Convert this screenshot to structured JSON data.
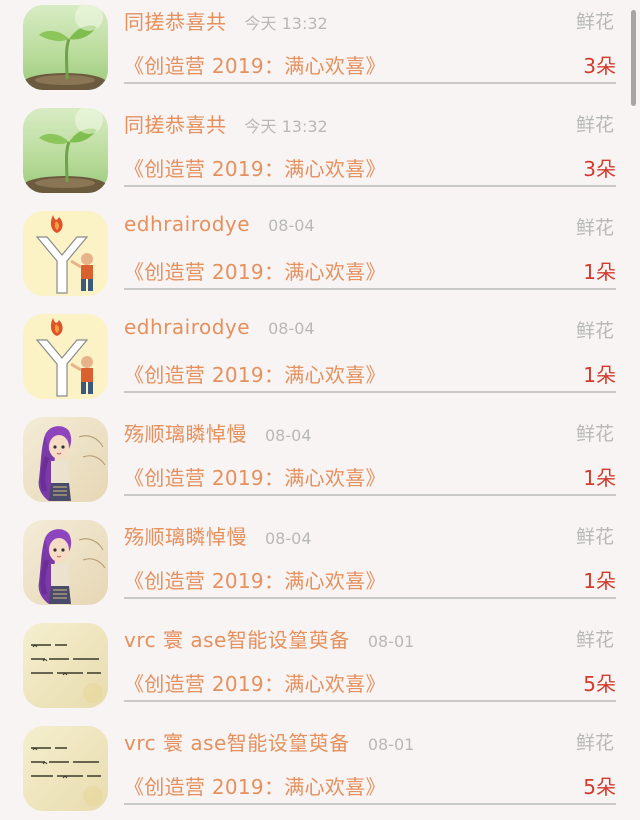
{
  "gift_list": {
    "items": [
      {
        "name": "同搓恭喜共",
        "time": "今天 13:32",
        "gift_type": "鲜花",
        "program": "《创造营 2019：满心欢喜》",
        "count": "3朵",
        "avatar_icon": "sprout-avatar-icon"
      },
      {
        "name": "同搓恭喜共",
        "time": "今天 13:32",
        "gift_type": "鲜花",
        "program": "《创造营 2019：满心欢喜》",
        "count": "3朵",
        "avatar_icon": "sprout-avatar-icon"
      },
      {
        "name": "edhrairodye",
        "time": "08-04",
        "gift_type": "鲜花",
        "program": "《创造营 2019：满心欢喜》",
        "count": "1朵",
        "avatar_icon": "torch-boy-avatar-icon"
      },
      {
        "name": "edhrairodye",
        "time": "08-04",
        "gift_type": "鲜花",
        "program": "《创造营 2019：满心欢喜》",
        "count": "1朵",
        "avatar_icon": "torch-boy-avatar-icon"
      },
      {
        "name": "殇顺璃瞵悼慢",
        "time": "08-04",
        "gift_type": "鲜花",
        "program": "《创造营 2019：满心欢喜》",
        "count": "1朵",
        "avatar_icon": "purple-hair-girl-avatar-icon"
      },
      {
        "name": "殇顺璃瞵悼慢",
        "time": "08-04",
        "gift_type": "鲜花",
        "program": "《创造营 2019：满心欢喜》",
        "count": "1朵",
        "avatar_icon": "purple-hair-girl-avatar-icon"
      },
      {
        "name": "vrc 寰 ase智能设篁萸备",
        "time": "08-01",
        "gift_type": "鲜花",
        "program": "《创造营 2019：满心欢喜》",
        "count": "5朵",
        "avatar_icon": "handwritten-note-avatar-icon"
      },
      {
        "name": "vrc 寰 ase智能设篁萸备",
        "time": "08-01",
        "gift_type": "鲜花",
        "program": "《创造营 2019：满心欢喜》",
        "count": "5朵",
        "avatar_icon": "handwritten-note-avatar-icon"
      }
    ]
  },
  "colors": {
    "background": "#f8f4f4",
    "name_text": "#e5905d",
    "muted_text": "#b8b8b8",
    "count_text": "#d33a2c",
    "divider": "#c9c9c9"
  }
}
